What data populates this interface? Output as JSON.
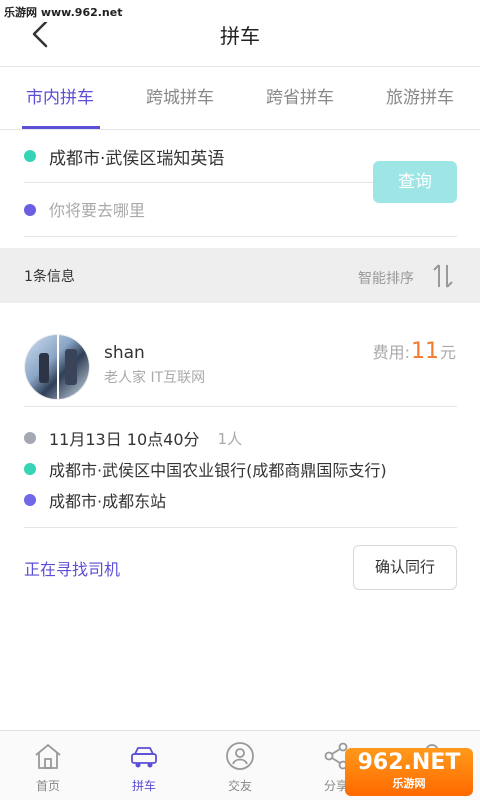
{
  "watermark": {
    "top_text": "乐游网 www.962.net",
    "logo_text": "962.NET",
    "logo_sub": "乐游网"
  },
  "header": {
    "title": "拼车"
  },
  "tabs": [
    {
      "label": "市内拼车",
      "active": true
    },
    {
      "label": "跨城拼车",
      "active": false
    },
    {
      "label": "跨省拼车",
      "active": false
    },
    {
      "label": "旅游拼车",
      "active": false
    }
  ],
  "route": {
    "from": "成都市·武侯区瑞知英语",
    "to_placeholder": "你将要去哪里",
    "query_label": "查询"
  },
  "info_bar": {
    "count": "1条信息",
    "sort_label": "智能排序"
  },
  "card": {
    "username": "shan",
    "subtitle": "老人家 IT互联网",
    "fee_label": "费用:",
    "fee_amount": "11",
    "fee_unit": "元",
    "time": "11月13日 10点40分",
    "seats": "1人",
    "from": "成都市·武侯区中国农业银行(成都商鼎国际支行)",
    "to": "成都市·成都东站",
    "status": "正在寻找司机",
    "confirm_label": "确认同行"
  },
  "bottom_nav": [
    {
      "label": "首页",
      "icon": "home-icon",
      "active": false
    },
    {
      "label": "拼车",
      "icon": "car-icon",
      "active": true
    },
    {
      "label": "交友",
      "icon": "friends-icon",
      "active": false
    },
    {
      "label": "分享",
      "icon": "share-icon",
      "active": false
    },
    {
      "label": "",
      "icon": "profile-icon",
      "active": false
    }
  ],
  "colors": {
    "accent": "#5b4fd6",
    "teal": "#35d4b6",
    "fee": "#f07b2d",
    "query_button": "#9ee6e6"
  }
}
